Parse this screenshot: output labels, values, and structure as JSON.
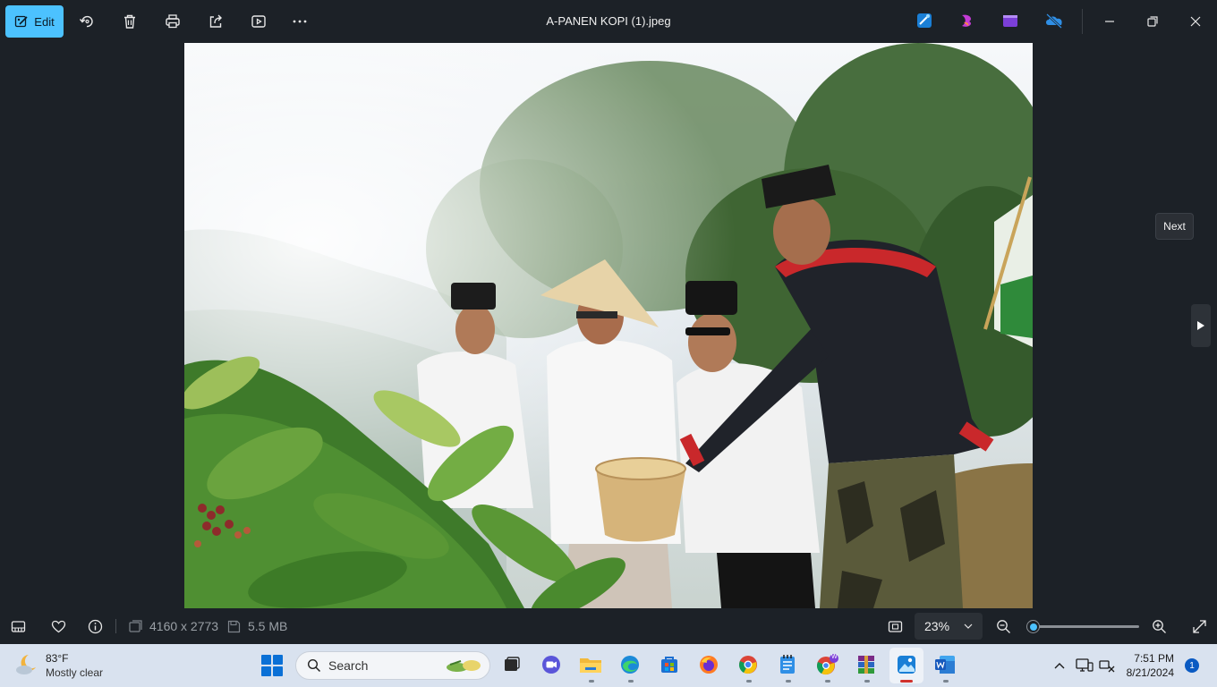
{
  "toolbar": {
    "edit_label": "Edit",
    "file_title": "A-PANEN KOPI (1).jpeg",
    "accent": "#4cc2ff"
  },
  "viewer": {
    "next_tooltip": "Next"
  },
  "statusbar": {
    "dimensions": "4160 x 2773",
    "file_size": "5.5 MB",
    "zoom": "23%",
    "zoom_level_fraction": 0.0
  },
  "taskbar": {
    "weather_temp": "83°F",
    "weather_desc": "Mostly clear",
    "search_label": "Search",
    "time": "7:51 PM",
    "date": "8/21/2024",
    "notification_count": "1",
    "chrome_profile_badge": "W"
  }
}
